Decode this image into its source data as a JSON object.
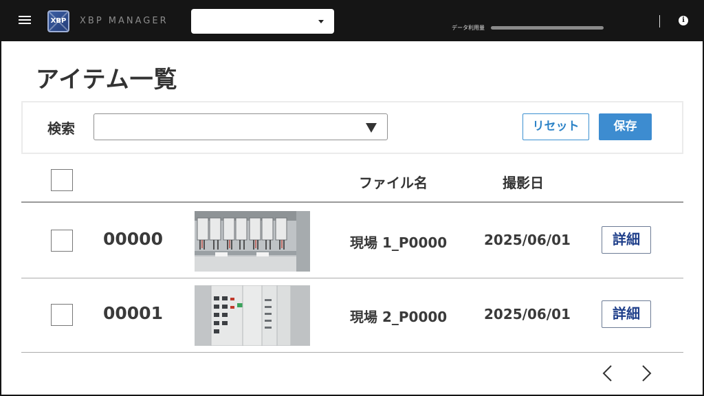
{
  "header": {
    "logo_text": "XBP",
    "app_name": "XBP MANAGER",
    "selector_value": "",
    "usage_label": "データ利用量",
    "usage_fraction": 0.0
  },
  "page": {
    "title": "アイテム一覧"
  },
  "search": {
    "label": "検索",
    "value": "",
    "reset_label": "リセット",
    "save_label": "保存"
  },
  "table": {
    "headers": {
      "file_name": "ファイル名",
      "shot_date": "撮影日"
    },
    "rows": [
      {
        "id": "00000",
        "file_name": "現場 1_P0000",
        "date": "2025/06/01",
        "detail_label": "詳細",
        "thumbnail": "switchboard-photo"
      },
      {
        "id": "00001",
        "file_name": "現場 2_P0000",
        "date": "2025/06/01",
        "detail_label": "詳細",
        "thumbnail": "panel-photo"
      }
    ]
  },
  "icons": {
    "menu": "menu-icon",
    "info": "info-icon",
    "prev": "chevron-left-icon",
    "next": "chevron-right-icon"
  }
}
